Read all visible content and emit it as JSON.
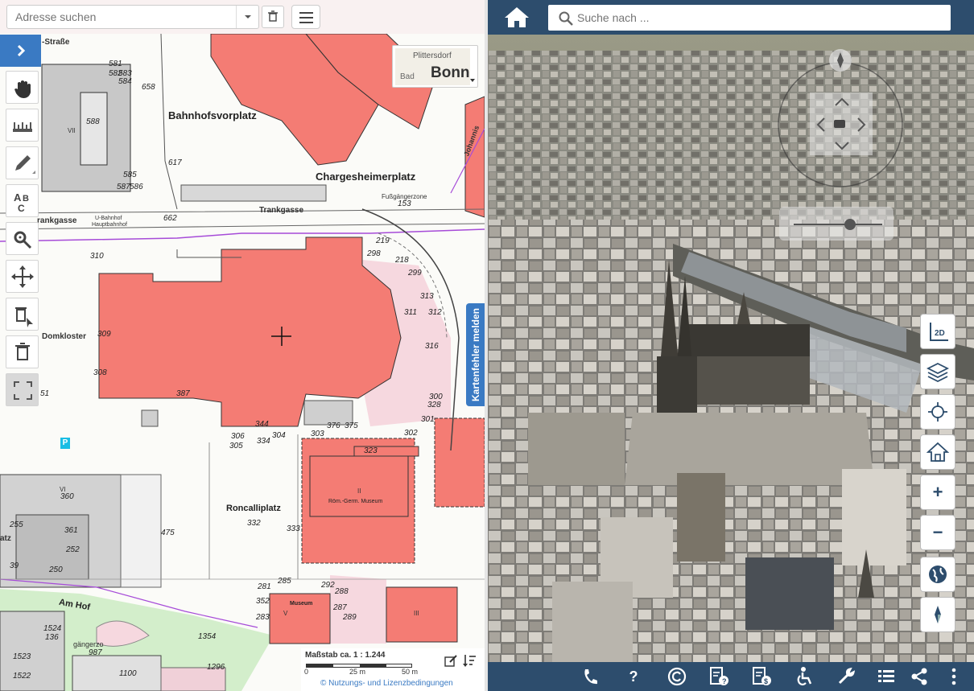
{
  "left_map": {
    "search": {
      "placeholder": "Adresse suchen"
    },
    "basemap": {
      "town": "Plittersdorf",
      "short": "Bad",
      "city": "Bonn"
    },
    "street_labels": {
      "strasse": "-Straße",
      "bahnhofsvorplatz": "Bahnhofsvorplatz",
      "chargesheimerplatz": "Chargesheimerplatz",
      "trankgasse": "Trankgasse",
      "trankgasse_west": "rankgasse",
      "ubahnhof": "U-Bahnhof",
      "hauptbahnhof": "Hauptbahnhof",
      "domkloster": "Domkloster",
      "roncalliplatz": "Roncalliplatz",
      "am_hof": "Am Hof",
      "johannis": "Johannis",
      "fussgaenger": "Fußgängerzone",
      "gaengerzo": "gängerzo",
      "museum_name": "Röm.-Germ. Museum",
      "museum2": "Museum",
      "atz": "atz"
    },
    "parcel_numbers": [
      "658",
      "588",
      "585",
      "587",
      "586",
      "617",
      "662",
      "581",
      "582",
      "583",
      "584",
      "310",
      "309",
      "308",
      "51",
      "387",
      "298",
      "219",
      "218",
      "299",
      "313",
      "311",
      "312",
      "328",
      "316",
      "300",
      "301",
      "302",
      "303",
      "304",
      "305",
      "306",
      "334",
      "344",
      "376",
      "375",
      "323",
      "332",
      "333",
      "475",
      "360",
      "361",
      "252",
      "250",
      "255",
      "39",
      "1524",
      "136",
      "1523",
      "1522",
      "1100",
      "987",
      "1354",
      "1296",
      "281",
      "285",
      "292",
      "288",
      "287",
      "289",
      "283",
      "352",
      "153"
    ],
    "roman_labels": {
      "vii": "VII",
      "ii": "II",
      "iii": "III",
      "v": "V",
      "vi": "VI"
    },
    "parking": "P",
    "report_tab": "Kartenfehler melden",
    "scale": {
      "label": "Maßstab ca. 1 : 1.244",
      "t0": "0",
      "t1": "25 m",
      "t2": "50 m"
    },
    "license": "© Nutzungs- und Lizenzbedingungen",
    "tools": [
      "pan-hand-icon",
      "measure-icon",
      "draw-pencil-icon",
      "text-label-icon",
      "settings-tools-icon",
      "move-edit-icon",
      "delete-select-icon",
      "trash-icon",
      "fullscreen-icon"
    ]
  },
  "right_view": {
    "search": {
      "placeholder": "Suche nach ..."
    },
    "controls": {
      "mode": "2D",
      "zoom_in": "+",
      "zoom_out": "−"
    },
    "bottom_icons": [
      "phone-icon",
      "help-icon",
      "copyright-icon",
      "info-doc-icon",
      "cost-doc-icon",
      "accessibility-icon",
      "wrench-icon",
      "list-icon",
      "share-icon",
      "more-icon"
    ],
    "help_glyph": "?"
  },
  "colors": {
    "building_red": "#f47c74",
    "header_blue": "#2d4d6d",
    "accent_blue": "#3a7ac3",
    "purple_boundary": "#a64bd8",
    "green_zone": "#d3eecb",
    "pink_zone": "#f6d8df"
  }
}
